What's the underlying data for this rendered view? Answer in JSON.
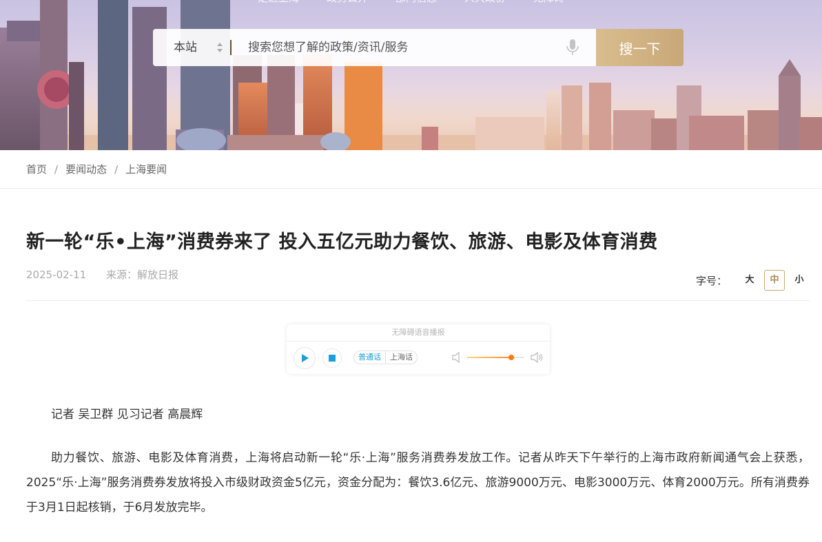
{
  "topnav": [
    "走进上海",
    "政务公开",
    "部门信息",
    "人大政协",
    "无障碍"
  ],
  "search": {
    "scope": "本站",
    "placeholder": "搜索您想了解的政策/资讯/服务",
    "button": "搜一下"
  },
  "breadcrumb": [
    "首页",
    "要闻动态",
    "上海要闻"
  ],
  "article": {
    "title": "新一轮“乐•上海”消费券来了 投入五亿元助力餐饮、旅游、电影及体育消费",
    "date": "2025-02-11",
    "source": "来源：解放日报",
    "paragraphs": [
      "记者 吴卫群 见习记者 高晨辉",
      "助力餐饮、旅游、电影及体育消费，上海将启动新一轮“乐·上海”服务消费券发放工作。记者从昨天下午举行的上海市政府新闻通气会上获悉，2025“乐·上海”服务消费券发放将投入市级财政资金5亿元，资金分配为：餐饮3.6亿元、旅游9000万元、电影3000万元、体育2000万元。所有消费券于3月1日起核销，于6月发放完毕。"
    ]
  },
  "fontsize": {
    "label": "字号：",
    "options": [
      "大",
      "中",
      "小"
    ],
    "selected": "中"
  },
  "player": {
    "title": "无障碍语音播报",
    "languages": [
      "普通话",
      "上海话"
    ],
    "active_language": "普通话",
    "volume": 0.78,
    "accent": "#1a9fd6"
  },
  "colors": {
    "search_button": "#c9a878",
    "volume": "#ff7a10"
  }
}
